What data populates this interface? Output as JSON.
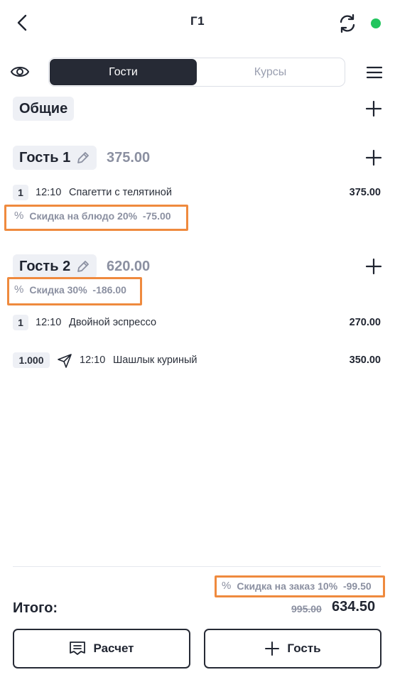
{
  "header": {
    "title": "Г1",
    "status_color": "#22c55e"
  },
  "tabs": [
    {
      "label": "Гости",
      "active": true
    },
    {
      "label": "Курсы",
      "active": false
    }
  ],
  "common_section": {
    "label": "Общие"
  },
  "guests": [
    {
      "label": "Гость 1",
      "total": "375.00",
      "items": [
        {
          "qty": "1",
          "time": "12:10",
          "name": "Спагетти с телятиной",
          "price": "375.00"
        }
      ],
      "item_discount": {
        "icon": "percent-icon",
        "text": "Скидка на блюдо 20%  -75.00"
      }
    },
    {
      "label": "Гость 2",
      "total": "620.00",
      "guest_discount": {
        "icon": "percent-icon",
        "text": "Скидка 30%  -186.00"
      },
      "items": [
        {
          "qty": "1",
          "time": "12:10",
          "name": "Двойной эспрессо",
          "price": "270.00"
        },
        {
          "qty": "1.000",
          "time": "12:10",
          "name": "Шашлык куриный",
          "price": "350.00",
          "icon": "send-icon"
        }
      ]
    }
  ],
  "order_discount": {
    "icon": "percent-icon",
    "text": "Скидка на заказ 10%  -99.50"
  },
  "footer": {
    "total_label": "Итого:",
    "old_total": "995.00",
    "new_total": "634.50",
    "pay_button": "Расчет",
    "add_guest_button": "Гость"
  },
  "colors": {
    "highlight": "#ef8a3e",
    "dark": "#262a35",
    "muted": "#8b90a1",
    "chip_bg": "#eef0f5"
  }
}
